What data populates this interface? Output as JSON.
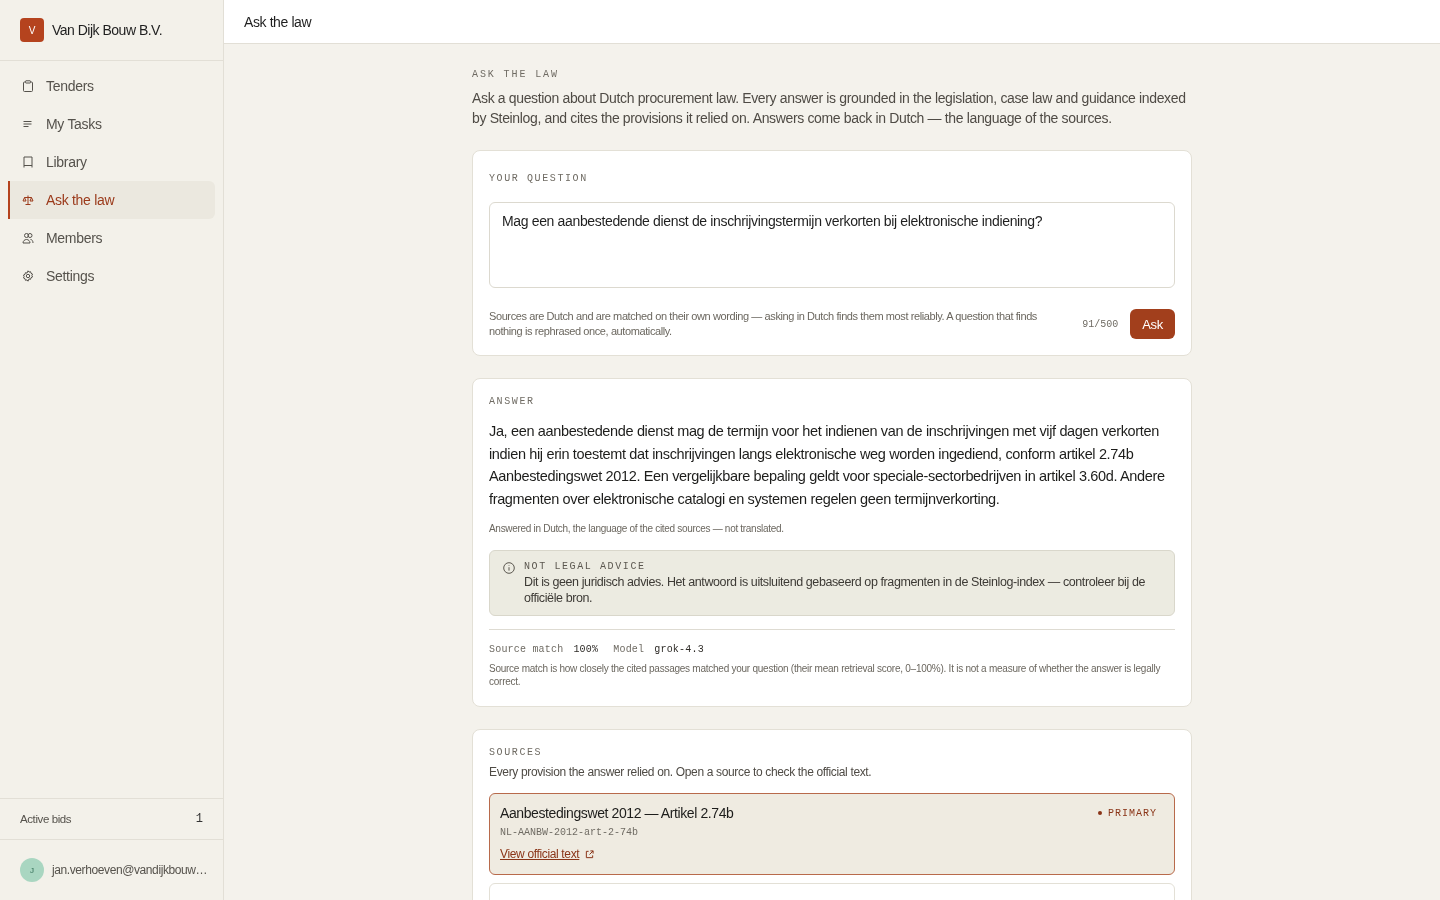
{
  "sidebar": {
    "brand": {
      "initial": "V",
      "name": "Van Dijk Bouw B.V."
    },
    "items": [
      {
        "label": "Tenders",
        "selected": false
      },
      {
        "label": "My Tasks",
        "selected": false
      },
      {
        "label": "Library",
        "selected": false
      },
      {
        "label": "Ask the law",
        "selected": true
      },
      {
        "label": "Members",
        "selected": false
      },
      {
        "label": "Settings",
        "selected": false
      }
    ],
    "stats": [
      {
        "label": "Active bids",
        "count": "1"
      }
    ],
    "user": {
      "initial": "J",
      "email": "jan.verhoeven@vandijkbouw…"
    }
  },
  "header": {
    "title": "Ask the law"
  },
  "intro": {
    "eyebrow": "ASK THE LAW",
    "text": "Ask a question about Dutch procurement law. Every answer is grounded in the legislation, case law and guidance indexed by Steinlog, and cites the provisions it relied on. Answers come back in Dutch — the language of the sources."
  },
  "question": {
    "label": "YOUR QUESTION",
    "value": "Mag een aanbestedende dienst de inschrijvingstermijn verkorten bij elektronische indiening?",
    "hint": "Sources are Dutch and are matched on their own wording — asking in Dutch finds them most reliably. A question that finds nothing is rephrased once, automatically.",
    "counter": "91/500",
    "button": "Ask"
  },
  "answer": {
    "label": "ANSWER",
    "text": "Ja, een aanbestedende dienst mag de termijn voor het indienen van de inschrijvingen met vijf dagen verkorten indien hij erin toestemt dat inschrijvingen langs elektronische weg worden ingediend, conform artikel 2.74b Aanbestedingswet 2012. Een vergelijkbare bepaling geldt voor speciale-sectorbedrijven in artikel 3.60d. Andere fragmenten over elektronische catalogi en systemen regelen geen termijnverkorting.",
    "note": "Answered in Dutch, the language of the cited sources — not translated.",
    "notice": {
      "title": "NOT LEGAL ADVICE",
      "text": "Dit is geen juridisch advies. Het antwoord is uitsluitend gebaseerd op fragmenten in de Steinlog-index — controleer bij de officiële bron."
    },
    "meta": [
      {
        "label": "Source match",
        "value": "100%"
      },
      {
        "label": "Model",
        "value": "grok-4.3"
      }
    ],
    "meta_note": "Source match is how closely the cited passages matched your question (their mean retrieval score, 0–100%). It is not a measure of whether the answer is legally correct."
  },
  "sources": {
    "label": "SOURCES",
    "description": "Every provision the answer relied on. Open a source to check the official text.",
    "items": [
      {
        "title": "Aanbestedingswet 2012 — Artikel 2.74b",
        "code": "NL-AANBW-2012-art-2-74b",
        "link": "View official text",
        "badge": "PRIMARY",
        "primary": true
      },
      {
        "primary": false
      }
    ]
  }
}
